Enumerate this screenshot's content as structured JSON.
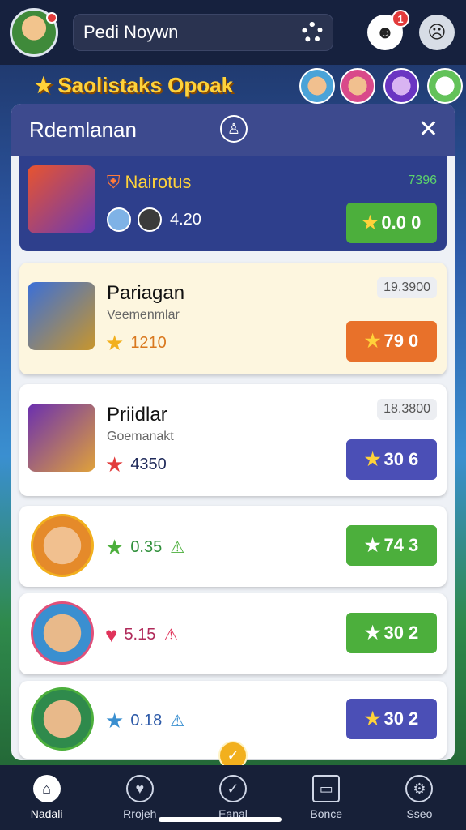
{
  "topbar": {
    "username": "Pedi Noywn",
    "notification_count": "1"
  },
  "banner": {
    "title": "Saolistaks Opoak"
  },
  "panel": {
    "title": "Rdemlanan"
  },
  "featured": {
    "name": "Nairotus",
    "reward_label": "7396",
    "score": "4.20",
    "button": "0.0 0"
  },
  "rows": [
    {
      "name": "Pariagan",
      "subtitle": "Veemenmlar",
      "score": "1210",
      "tag": "19.3900",
      "button": "79 0",
      "button_color": "#e8712a"
    },
    {
      "name": "Priidlar",
      "subtitle": "Goemanakt",
      "score": "4350",
      "tag": "18.3800",
      "button": "30 6",
      "button_color": "#4b4fb6"
    },
    {
      "name": "",
      "subtitle": "",
      "score": "0.35",
      "tag": "",
      "button": "74 3",
      "button_color": "#4caf3c"
    },
    {
      "name": "",
      "subtitle": "",
      "score": "5.15",
      "tag": "",
      "button": "30 2",
      "button_color": "#4caf3c"
    },
    {
      "name": "",
      "subtitle": "",
      "score": "0.18",
      "tag": "",
      "button": "30 2",
      "button_color": "#4b4fb6"
    }
  ],
  "nav": [
    {
      "label": "Nadali",
      "icon": "home-icon"
    },
    {
      "label": "Rrojeh",
      "icon": "shield-icon"
    },
    {
      "label": "Eanal",
      "icon": "check-icon"
    },
    {
      "label": "Bonce",
      "icon": "tv-icon"
    },
    {
      "label": "Sseo",
      "icon": "gear-icon"
    }
  ]
}
